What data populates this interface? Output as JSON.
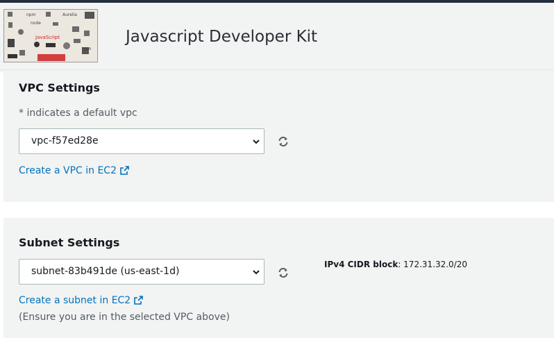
{
  "header": {
    "logo_text": "JavaScript",
    "title": "Javascript Developer Kit"
  },
  "vpc": {
    "title": "VPC Settings",
    "hint": "* indicates a default vpc",
    "selected": "vpc-f57ed28e",
    "create_link": "Create a VPC in EC2"
  },
  "subnet": {
    "title": "Subnet Settings",
    "selected": "subnet-83b491de (us-east-1d)",
    "create_link": "Create a subnet in EC2",
    "note": "(Ensure you are in the selected VPC above)",
    "cidr_label": "IPv4 CIDR block",
    "cidr_value": "172.31.32.0/20"
  },
  "colors": {
    "link": "#0073bb",
    "panel": "#f2f3f3",
    "topbar": "#232f3e"
  }
}
